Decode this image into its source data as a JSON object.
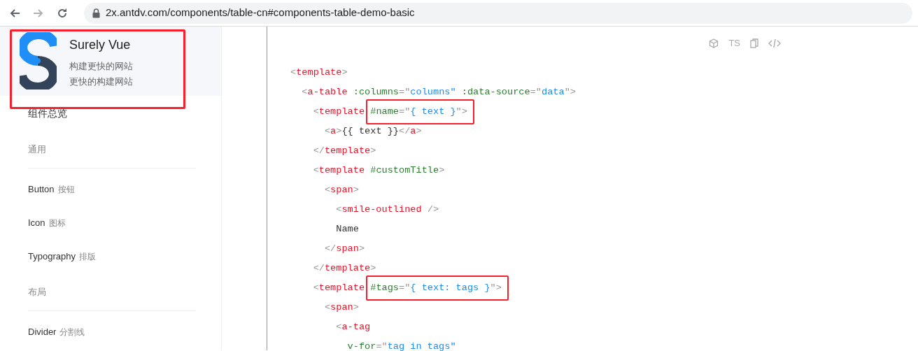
{
  "browser": {
    "nav_buttons": [
      {
        "kind": "back",
        "disabled": false
      },
      {
        "kind": "forward",
        "disabled": true
      },
      {
        "kind": "reload",
        "disabled": false
      }
    ],
    "url": "2x.antdv.com/components/table-cn#components-table-demo-basic"
  },
  "brand": {
    "name": "Surely Vue",
    "taglines": [
      "构建更快的网站",
      "更快的构建网站"
    ],
    "highlighted": true
  },
  "sidebar": {
    "items": [
      {
        "kind": "item",
        "label": "组件总览"
      },
      {
        "kind": "group",
        "label": "通用"
      },
      {
        "kind": "item",
        "label": "Button",
        "sub": "按钮"
      },
      {
        "kind": "item",
        "label": "Icon",
        "sub": "图标"
      },
      {
        "kind": "item",
        "label": "Typography",
        "sub": "排版"
      },
      {
        "kind": "group",
        "label": "布局"
      },
      {
        "kind": "item",
        "label": "Divider",
        "sub": "分割线"
      }
    ]
  },
  "code_toolbar": [
    {
      "kind": "cube"
    },
    {
      "kind": "text",
      "label": "TS"
    },
    {
      "kind": "copy"
    },
    {
      "kind": "code"
    }
  ],
  "code_lines": [
    [
      {
        "kind": "text",
        "t": "<",
        "color": "#999999"
      },
      {
        "kind": "text",
        "t": "template",
        "color": "#e8142a"
      },
      {
        "kind": "text",
        "t": ">",
        "color": "#999999"
      }
    ],
    [
      {
        "kind": "text",
        "t": "  <",
        "color": "#999999"
      },
      {
        "kind": "text",
        "t": "a-table",
        "color": "#e8142a"
      },
      {
        "kind": "text",
        "t": " :columns",
        "color": "#2b7f2f"
      },
      {
        "kind": "text",
        "t": "=\"",
        "color": "#999999"
      },
      {
        "kind": "text",
        "t": "columns\"",
        "color": "#1f8bf2"
      },
      {
        "kind": "text",
        "t": " :data-source",
        "color": "#2b7f2f"
      },
      {
        "kind": "text",
        "t": "=\"",
        "color": "#999999"
      },
      {
        "kind": "text",
        "t": "data",
        "color": "#1f8bf2"
      },
      {
        "kind": "text",
        "t": "\">",
        "color": "#999999"
      }
    ],
    [
      {
        "kind": "text",
        "t": "    <",
        "color": "#999999"
      },
      {
        "kind": "text",
        "t": "template ",
        "color": "#e8142a"
      },
      {
        "kind": "highlight",
        "tokens": [
          {
            "t": "#name",
            "color": "#2b7f2f"
          },
          {
            "t": "=\"",
            "color": "#999999"
          },
          {
            "t": "{ text }",
            "color": "#1f8bf2"
          },
          {
            "t": "\">",
            "color": "#999999"
          }
        ]
      }
    ],
    [
      {
        "kind": "text",
        "t": "      <",
        "color": "#999999"
      },
      {
        "kind": "text",
        "t": "a",
        "color": "#e8142a"
      },
      {
        "kind": "text",
        "t": ">",
        "color": "#999999"
      },
      {
        "kind": "text",
        "t": "{{ text }}",
        "color": "#333333"
      },
      {
        "kind": "text",
        "t": "</",
        "color": "#999999"
      },
      {
        "kind": "text",
        "t": "a",
        "color": "#e8142a"
      },
      {
        "kind": "text",
        "t": ">",
        "color": "#999999"
      }
    ],
    [
      {
        "kind": "text",
        "t": "    </",
        "color": "#999999"
      },
      {
        "kind": "text",
        "t": "template",
        "color": "#e8142a"
      },
      {
        "kind": "text",
        "t": ">",
        "color": "#999999"
      }
    ],
    [
      {
        "kind": "text",
        "t": "    <",
        "color": "#999999"
      },
      {
        "kind": "text",
        "t": "template",
        "color": "#e8142a"
      },
      {
        "kind": "text",
        "t": " #customTitle",
        "color": "#2b7f2f"
      },
      {
        "kind": "text",
        "t": ">",
        "color": "#999999"
      }
    ],
    [
      {
        "kind": "text",
        "t": "      <",
        "color": "#999999"
      },
      {
        "kind": "text",
        "t": "span",
        "color": "#e8142a"
      },
      {
        "kind": "text",
        "t": ">",
        "color": "#999999"
      }
    ],
    [
      {
        "kind": "text",
        "t": "        <",
        "color": "#999999"
      },
      {
        "kind": "text",
        "t": "smile-outlined",
        "color": "#e8142a"
      },
      {
        "kind": "text",
        "t": " />",
        "color": "#999999"
      }
    ],
    [
      {
        "kind": "text",
        "t": "        Name",
        "color": "#333333"
      }
    ],
    [
      {
        "kind": "text",
        "t": "      </",
        "color": "#999999"
      },
      {
        "kind": "text",
        "t": "span",
        "color": "#e8142a"
      },
      {
        "kind": "text",
        "t": ">",
        "color": "#999999"
      }
    ],
    [
      {
        "kind": "text",
        "t": "    </",
        "color": "#999999"
      },
      {
        "kind": "text",
        "t": "template",
        "color": "#e8142a"
      },
      {
        "kind": "text",
        "t": ">",
        "color": "#999999"
      }
    ],
    [
      {
        "kind": "text",
        "t": "    <",
        "color": "#999999"
      },
      {
        "kind": "text",
        "t": "template ",
        "color": "#e8142a"
      },
      {
        "kind": "highlight",
        "tokens": [
          {
            "t": "#tags",
            "color": "#2b7f2f"
          },
          {
            "t": "=\"",
            "color": "#999999"
          },
          {
            "t": "{ text: tags }",
            "color": "#1f8bf2"
          },
          {
            "t": "\">",
            "color": "#999999"
          }
        ]
      }
    ],
    [
      {
        "kind": "text",
        "t": "      <",
        "color": "#999999"
      },
      {
        "kind": "text",
        "t": "span",
        "color": "#e8142a"
      },
      {
        "kind": "text",
        "t": ">",
        "color": "#999999"
      }
    ],
    [
      {
        "kind": "text",
        "t": "        <",
        "color": "#999999"
      },
      {
        "kind": "text",
        "t": "a-tag",
        "color": "#e8142a"
      }
    ],
    [
      {
        "kind": "text",
        "t": "          v-for",
        "color": "#2b7f2f"
      },
      {
        "kind": "text",
        "t": "=\"",
        "color": "#999999"
      },
      {
        "kind": "text",
        "t": "tag in tags\"",
        "color": "#1f8bf2"
      }
    ]
  ]
}
